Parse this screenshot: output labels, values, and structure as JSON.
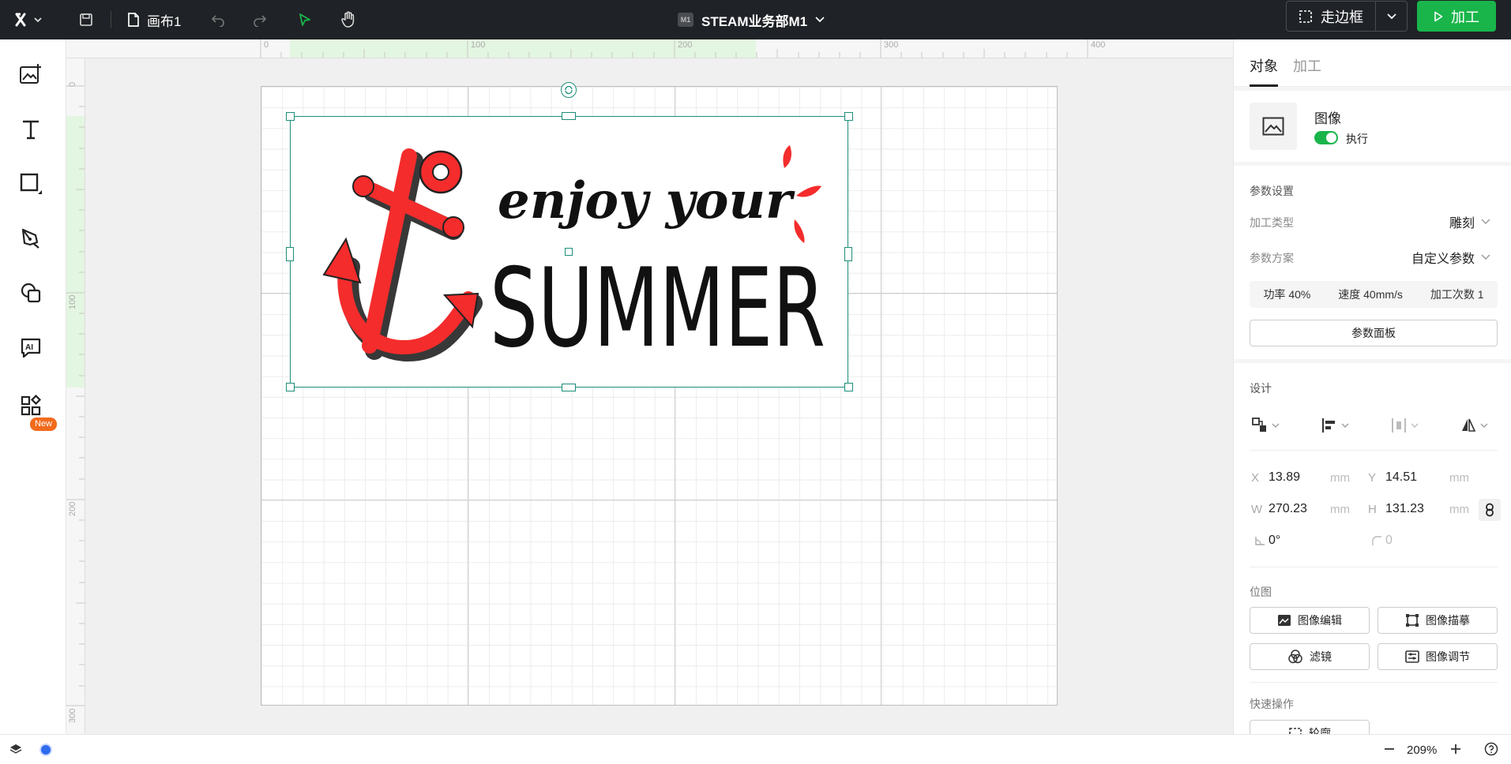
{
  "topbar": {
    "doc_name": "画布1",
    "device_badge": "M1",
    "device_name": "STEAM业务部M1",
    "frame_label": "走边框",
    "process_label": "加工"
  },
  "toolbar_left": {
    "new_badge": "New"
  },
  "ruler": {
    "h_labels": [
      "0",
      "100",
      "200",
      "300",
      "400"
    ],
    "v_labels": [
      "0",
      "100",
      "200",
      "300"
    ]
  },
  "artwork": {
    "line1": "enjoy your",
    "line2": "SUMMER",
    "colors": {
      "anchor": "#f42c2c",
      "text": "#111111",
      "accent": "#19b54b",
      "selection": "#1d8d79"
    }
  },
  "panel": {
    "tabs": [
      "对象",
      "加工"
    ],
    "object_type": "图像",
    "execute_label": "执行",
    "params_title": "参数设置",
    "process_type_label": "加工类型",
    "process_type_value": "雕刻",
    "scheme_label": "参数方案",
    "scheme_value": "自定义参数",
    "power": "功率 40%",
    "speed": "速度 40mm/s",
    "passes": "加工次数 1",
    "param_panel_btn": "参数面板",
    "design_title": "设计",
    "x_label": "X",
    "x_value": "13.89",
    "y_label": "Y",
    "y_value": "14.51",
    "w_label": "W",
    "w_value": "270.23",
    "h_label": "H",
    "h_value": "131.23",
    "unit": "mm",
    "angle_value": "0°",
    "radius_value": "0",
    "bitmap_title": "位图",
    "btn_image_edit": "图像编辑",
    "btn_image_trace": "图像描摹",
    "btn_filter": "滤镜",
    "btn_image_adjust": "图像调节",
    "quick_title": "快速操作",
    "quick_btn": "轮廓"
  },
  "bottombar": {
    "zoom": "209%"
  }
}
